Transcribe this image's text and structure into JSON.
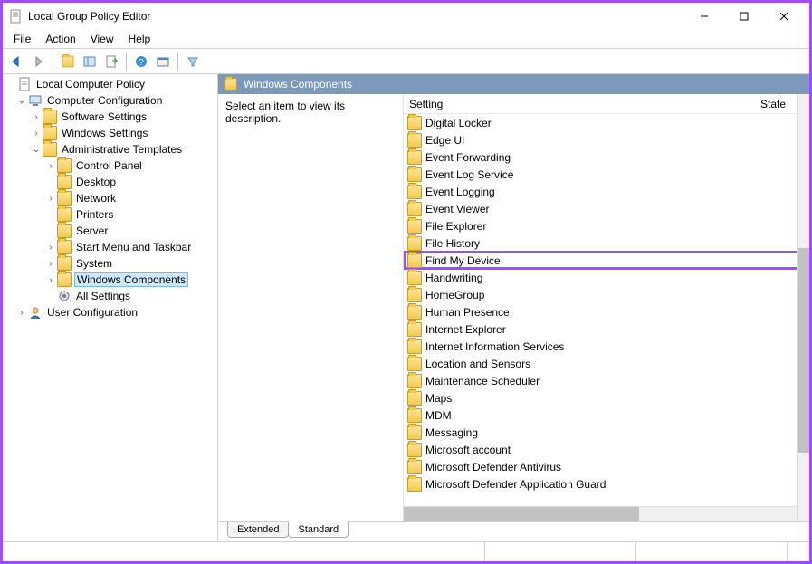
{
  "window": {
    "title": "Local Group Policy Editor"
  },
  "menu": {
    "items": [
      "File",
      "Action",
      "View",
      "Help"
    ]
  },
  "toolbar": {
    "buttons": [
      {
        "name": "back",
        "glyph": "⬅"
      },
      {
        "name": "forward",
        "glyph": "➡"
      },
      {
        "name": "up-folder",
        "glyph": "📁"
      },
      {
        "name": "show-tree",
        "glyph": "▦"
      },
      {
        "name": "export-list",
        "glyph": "📄"
      },
      {
        "name": "help",
        "glyph": "?"
      },
      {
        "name": "properties",
        "glyph": "▭"
      },
      {
        "name": "filter",
        "glyph": "▽"
      }
    ]
  },
  "tree": {
    "root": "Local Computer Policy",
    "computer_config": "Computer Configuration",
    "software_settings": "Software Settings",
    "windows_settings": "Windows Settings",
    "admin_templates": "Administrative Templates",
    "control_panel": "Control Panel",
    "desktop": "Desktop",
    "network": "Network",
    "printers": "Printers",
    "server": "Server",
    "start_menu": "Start Menu and Taskbar",
    "system": "System",
    "windows_components": "Windows Components",
    "all_settings": "All Settings",
    "user_config": "User Configuration"
  },
  "details": {
    "header": "Windows Components",
    "description": "Select an item to view its description.",
    "columns": {
      "setting": "Setting",
      "state": "State"
    },
    "items": [
      "Digital Locker",
      "Edge UI",
      "Event Forwarding",
      "Event Log Service",
      "Event Logging",
      "Event Viewer",
      "File Explorer",
      "File History",
      "Find My Device",
      "Handwriting",
      "HomeGroup",
      "Human Presence",
      "Internet Explorer",
      "Internet Information Services",
      "Location and Sensors",
      "Maintenance Scheduler",
      "Maps",
      "MDM",
      "Messaging",
      "Microsoft account",
      "Microsoft Defender Antivirus",
      "Microsoft Defender Application Guard"
    ],
    "highlight_index": 8
  },
  "tabs": {
    "extended": "Extended",
    "standard": "Standard"
  }
}
